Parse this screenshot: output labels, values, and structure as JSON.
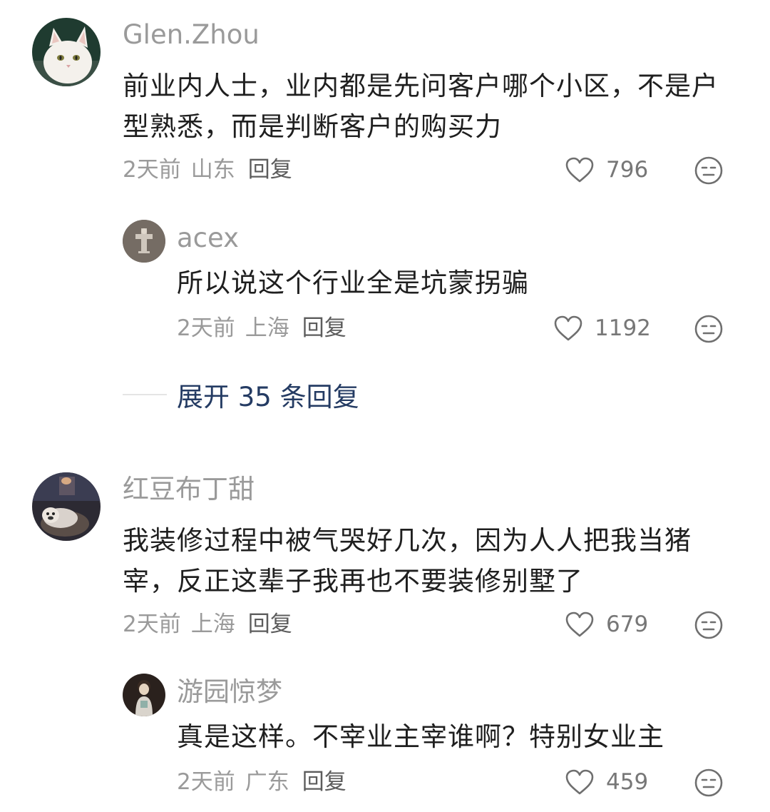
{
  "comments": [
    {
      "username": "Glen.Zhou",
      "text": "前业内人士，业内都是先问客户哪个小区，不是户型熟悉，而是判断客户的购买力",
      "time": "2天前",
      "location": "山东",
      "reply_label": "回复",
      "likes": "796",
      "replies": [
        {
          "username": "acex",
          "text": "所以说这个行业全是坑蒙拐骗",
          "time": "2天前",
          "location": "上海",
          "reply_label": "回复",
          "likes": "1192"
        }
      ],
      "expand_label": "展开 35 条回复"
    },
    {
      "username": "红豆布丁甜",
      "text": "我装修过程中被气哭好几次，因为人人把我当猪宰，反正这辈子我再也不要装修别墅了",
      "time": "2天前",
      "location": "上海",
      "reply_label": "回复",
      "likes": "679",
      "replies": [
        {
          "username": "游园惊梦",
          "text": "真是这样。不宰业主宰谁啊？特别女业主",
          "time": "2天前",
          "location": "广东",
          "reply_label": "回复",
          "likes": "459"
        }
      ]
    }
  ],
  "icons": {
    "like": "heart-outline-icon",
    "dislike": "neutral-face-icon"
  },
  "colors": {
    "username": "#9a9a9a",
    "text": "#1f1f1f",
    "expand_link": "#243b63"
  }
}
